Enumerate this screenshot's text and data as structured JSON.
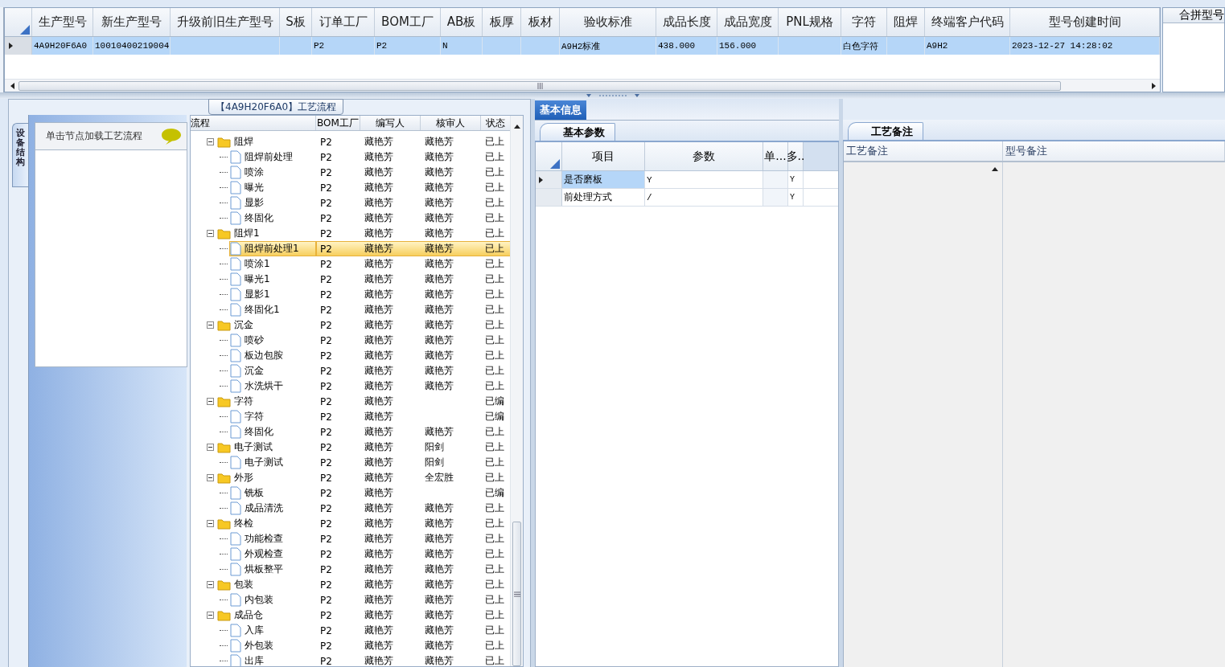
{
  "model_grid": {
    "columns": [
      {
        "header": "生产型号",
        "cell": "4A9H20F6A0"
      },
      {
        "header": "新生产型号",
        "cell": "10010400219004"
      },
      {
        "header": "升级前旧生产型号"
      },
      {
        "header": "S板"
      },
      {
        "header": "订单工厂",
        "cell": "P2"
      },
      {
        "header": "BOM工厂",
        "cell": "P2"
      },
      {
        "header": "AB板",
        "cell": "N"
      },
      {
        "header": "板厚"
      },
      {
        "header": "板材"
      },
      {
        "header": "验收标准",
        "cell": "A9H2标准"
      },
      {
        "header": "成品长度",
        "cell": "438.000"
      },
      {
        "header": "成品宽度",
        "cell": "156.000"
      },
      {
        "header": "PNL规格"
      },
      {
        "header": "字符",
        "cell": "白色字符"
      },
      {
        "header": "阻焊"
      },
      {
        "header": "终端客户代码",
        "cell": "A9H2"
      },
      {
        "header": "型号创建时间",
        "cell": "2023-12-27 14:28:02"
      }
    ],
    "row_selected": true
  },
  "merge_panel": {
    "header": "合拼型号"
  },
  "process_group": {
    "title": "【4A9H20F6A0】工艺流程",
    "side_tab": "设备结构",
    "hint": "单击节点加载工艺流程",
    "tree": {
      "columns": [
        "流程",
        "BOM工厂",
        "编写人",
        "核审人",
        "状态"
      ],
      "rows": [
        {
          "name": "阻焊",
          "bom": "P2",
          "writer": "藏艳芳",
          "reviewer": "藏艳芳",
          "status": "已上",
          "expanded": true,
          "selected": false,
          "children": [
            {
              "name": "阻焊前处理",
              "bom": "P2",
              "writer": "藏艳芳",
              "reviewer": "藏艳芳",
              "status": "已上",
              "selected": false
            },
            {
              "name": "喷涂",
              "bom": "P2",
              "writer": "藏艳芳",
              "reviewer": "藏艳芳",
              "status": "已上",
              "selected": false
            },
            {
              "name": "曝光",
              "bom": "P2",
              "writer": "藏艳芳",
              "reviewer": "藏艳芳",
              "status": "已上",
              "selected": false
            },
            {
              "name": "显影",
              "bom": "P2",
              "writer": "藏艳芳",
              "reviewer": "藏艳芳",
              "status": "已上",
              "selected": false
            },
            {
              "name": "终固化",
              "bom": "P2",
              "writer": "藏艳芳",
              "reviewer": "藏艳芳",
              "status": "已上",
              "selected": false
            }
          ]
        },
        {
          "name": "阻焊1",
          "bom": "P2",
          "writer": "藏艳芳",
          "reviewer": "藏艳芳",
          "status": "已上",
          "expanded": true,
          "selected": false,
          "children": [
            {
              "name": "阻焊前处理1",
              "bom": "P2",
              "writer": "藏艳芳",
              "reviewer": "藏艳芳",
              "status": "已上",
              "selected": true
            },
            {
              "name": "喷涂1",
              "bom": "P2",
              "writer": "藏艳芳",
              "reviewer": "藏艳芳",
              "status": "已上",
              "selected": false
            },
            {
              "name": "曝光1",
              "bom": "P2",
              "writer": "藏艳芳",
              "reviewer": "藏艳芳",
              "status": "已上",
              "selected": false
            },
            {
              "name": "显影1",
              "bom": "P2",
              "writer": "藏艳芳",
              "reviewer": "藏艳芳",
              "status": "已上",
              "selected": false
            },
            {
              "name": "终固化1",
              "bom": "P2",
              "writer": "藏艳芳",
              "reviewer": "藏艳芳",
              "status": "已上",
              "selected": false
            }
          ]
        },
        {
          "name": "沉金",
          "bom": "P2",
          "writer": "藏艳芳",
          "reviewer": "藏艳芳",
          "status": "已上",
          "expanded": true,
          "selected": false,
          "children": [
            {
              "name": "喷砂",
              "bom": "P2",
              "writer": "藏艳芳",
              "reviewer": "藏艳芳",
              "status": "已上",
              "selected": false
            },
            {
              "name": "板边包胺",
              "bom": "P2",
              "writer": "藏艳芳",
              "reviewer": "藏艳芳",
              "status": "已上",
              "selected": false
            },
            {
              "name": "沉金",
              "bom": "P2",
              "writer": "藏艳芳",
              "reviewer": "藏艳芳",
              "status": "已上",
              "selected": false
            },
            {
              "name": "水洗烘干",
              "bom": "P2",
              "writer": "藏艳芳",
              "reviewer": "藏艳芳",
              "status": "已上",
              "selected": false
            }
          ]
        },
        {
          "name": "字符",
          "bom": "P2",
          "writer": "藏艳芳",
          "status": "已编",
          "expanded": true,
          "selected": false,
          "children": [
            {
              "name": "字符",
              "bom": "P2",
              "writer": "藏艳芳",
              "status": "已编",
              "selected": false
            },
            {
              "name": "终固化",
              "bom": "P2",
              "writer": "藏艳芳",
              "reviewer": "藏艳芳",
              "status": "已上",
              "selected": false
            }
          ]
        },
        {
          "name": "电子测试",
          "bom": "P2",
          "writer": "藏艳芳",
          "reviewer": "阳剑",
          "status": "已上",
          "expanded": true,
          "selected": false,
          "children": [
            {
              "name": "电子测试",
              "bom": "P2",
              "writer": "藏艳芳",
              "reviewer": "阳剑",
              "status": "已上",
              "selected": false
            }
          ]
        },
        {
          "name": "外形",
          "bom": "P2",
          "writer": "藏艳芳",
          "reviewer": "全宏胜",
          "status": "已上",
          "expanded": true,
          "selected": false,
          "children": [
            {
              "name": "铣板",
              "bom": "P2",
              "writer": "藏艳芳",
              "status": "已编",
              "selected": false
            },
            {
              "name": "成品清洗",
              "bom": "P2",
              "writer": "藏艳芳",
              "reviewer": "藏艳芳",
              "status": "已上",
              "selected": false
            }
          ]
        },
        {
          "name": "终检",
          "bom": "P2",
          "writer": "藏艳芳",
          "reviewer": "藏艳芳",
          "status": "已上",
          "expanded": true,
          "selected": false,
          "children": [
            {
              "name": "功能检查",
              "bom": "P2",
              "writer": "藏艳芳",
              "reviewer": "藏艳芳",
              "status": "已上",
              "selected": false
            },
            {
              "name": "外观检查",
              "bom": "P2",
              "writer": "藏艳芳",
              "reviewer": "藏艳芳",
              "status": "已上",
              "selected": false
            },
            {
              "name": "烘板整平",
              "bom": "P2",
              "writer": "藏艳芳",
              "reviewer": "藏艳芳",
              "status": "已上",
              "selected": false
            }
          ]
        },
        {
          "name": "包装",
          "bom": "P2",
          "writer": "藏艳芳",
          "reviewer": "藏艳芳",
          "status": "已上",
          "expanded": true,
          "selected": false,
          "children": [
            {
              "name": "内包装",
              "bom": "P2",
              "writer": "藏艳芳",
              "reviewer": "藏艳芳",
              "status": "已上",
              "selected": false
            }
          ]
        },
        {
          "name": "成品仓",
          "bom": "P2",
          "writer": "藏艳芳",
          "reviewer": "藏艳芳",
          "status": "已上",
          "expanded": true,
          "selected": false,
          "children": [
            {
              "name": "入库",
              "bom": "P2",
              "writer": "藏艳芳",
              "reviewer": "藏艳芳",
              "status": "已上",
              "selected": false
            },
            {
              "name": "外包装",
              "bom": "P2",
              "writer": "藏艳芳",
              "reviewer": "藏艳芳",
              "status": "已上",
              "selected": false
            },
            {
              "name": "出库",
              "bom": "P2",
              "writer": "藏艳芳",
              "reviewer": "藏艳芳",
              "status": "已上",
              "selected": false
            }
          ]
        }
      ]
    }
  },
  "basic_info": {
    "tab": "基本信息",
    "sub_tab": "基本参数",
    "grid": {
      "columns": [
        "项目",
        "参数",
        "单...",
        "多.."
      ],
      "rows": [
        {
          "item": "是否磨板",
          "param": "Y",
          "flag": "Y",
          "selected": true
        },
        {
          "item": "前处理方式",
          "param": "/",
          "flag": "Y",
          "selected": false
        }
      ]
    }
  },
  "process_notes": {
    "tab": "工艺备注",
    "columns": [
      "工艺备注",
      "型号备注"
    ]
  }
}
